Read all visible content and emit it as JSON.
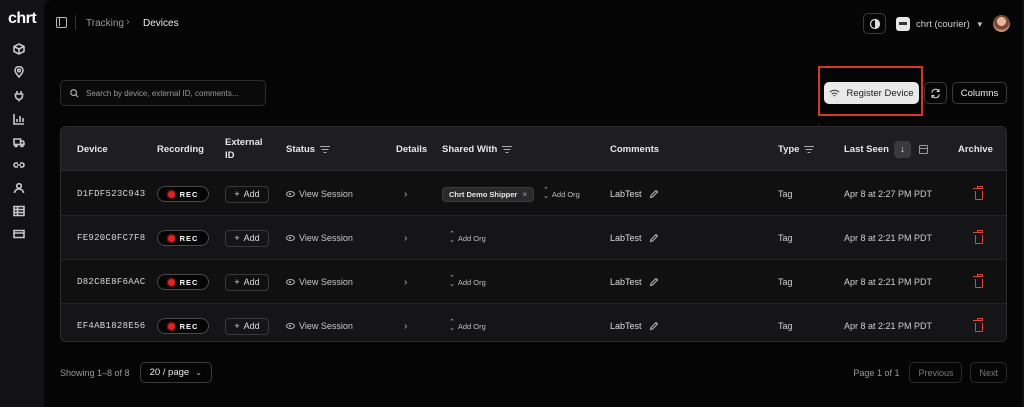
{
  "app": {
    "logo": "chrt"
  },
  "breadcrumb": {
    "parent": "Tracking",
    "separator": "›",
    "current": "Devices"
  },
  "rail": {
    "icons": [
      "package-icon",
      "map-pin-icon",
      "plug-icon",
      "bar-chart-icon",
      "truck-icon",
      "link-icon",
      "user-icon",
      "table-icon",
      "credit-card-icon"
    ]
  },
  "header": {
    "org_name": "chrt (courier)"
  },
  "toolbar": {
    "search_placeholder": "Search by device, external ID, comments...",
    "register_label": "Register Device",
    "columns_label": "Columns"
  },
  "table": {
    "headers": {
      "device": "Device",
      "recording": "Recording",
      "external_id": "External ID",
      "status": "Status",
      "details": "Details",
      "shared_with": "Shared With",
      "comments": "Comments",
      "type": "Type",
      "last_seen": "Last Seen",
      "archive": "Archive"
    },
    "rec_label": "REC",
    "add_label": "Add",
    "view_session_label": "View Session",
    "add_org_label": "Add Org",
    "rows": [
      {
        "device": "D1FDF523C943",
        "shared_tag": "Chrt Demo Shipper",
        "comment": "LabTest",
        "type": "Tag",
        "last_seen": "Apr 8 at 2:27 PM PDT"
      },
      {
        "device": "FE920C0FC7F8",
        "shared_tag": "",
        "comment": "LabTest",
        "type": "Tag",
        "last_seen": "Apr 8 at 2:21 PM PDT"
      },
      {
        "device": "D82C8E8F6AAC",
        "shared_tag": "",
        "comment": "LabTest",
        "type": "Tag",
        "last_seen": "Apr 8 at 2:21 PM PDT"
      },
      {
        "device": "EF4AB1828E56",
        "shared_tag": "",
        "comment": "LabTest",
        "type": "Tag",
        "last_seen": "Apr 8 at 2:21 PM PDT"
      }
    ]
  },
  "footer": {
    "showing": "Showing 1–8 of 8",
    "page_size": "20 / page",
    "page_info": "Page 1 of 1",
    "previous": "Previous",
    "next": "Next"
  },
  "colors": {
    "accent_red": "#d6362b",
    "rec_red": "#e02222",
    "trash_red": "#e0453c"
  }
}
